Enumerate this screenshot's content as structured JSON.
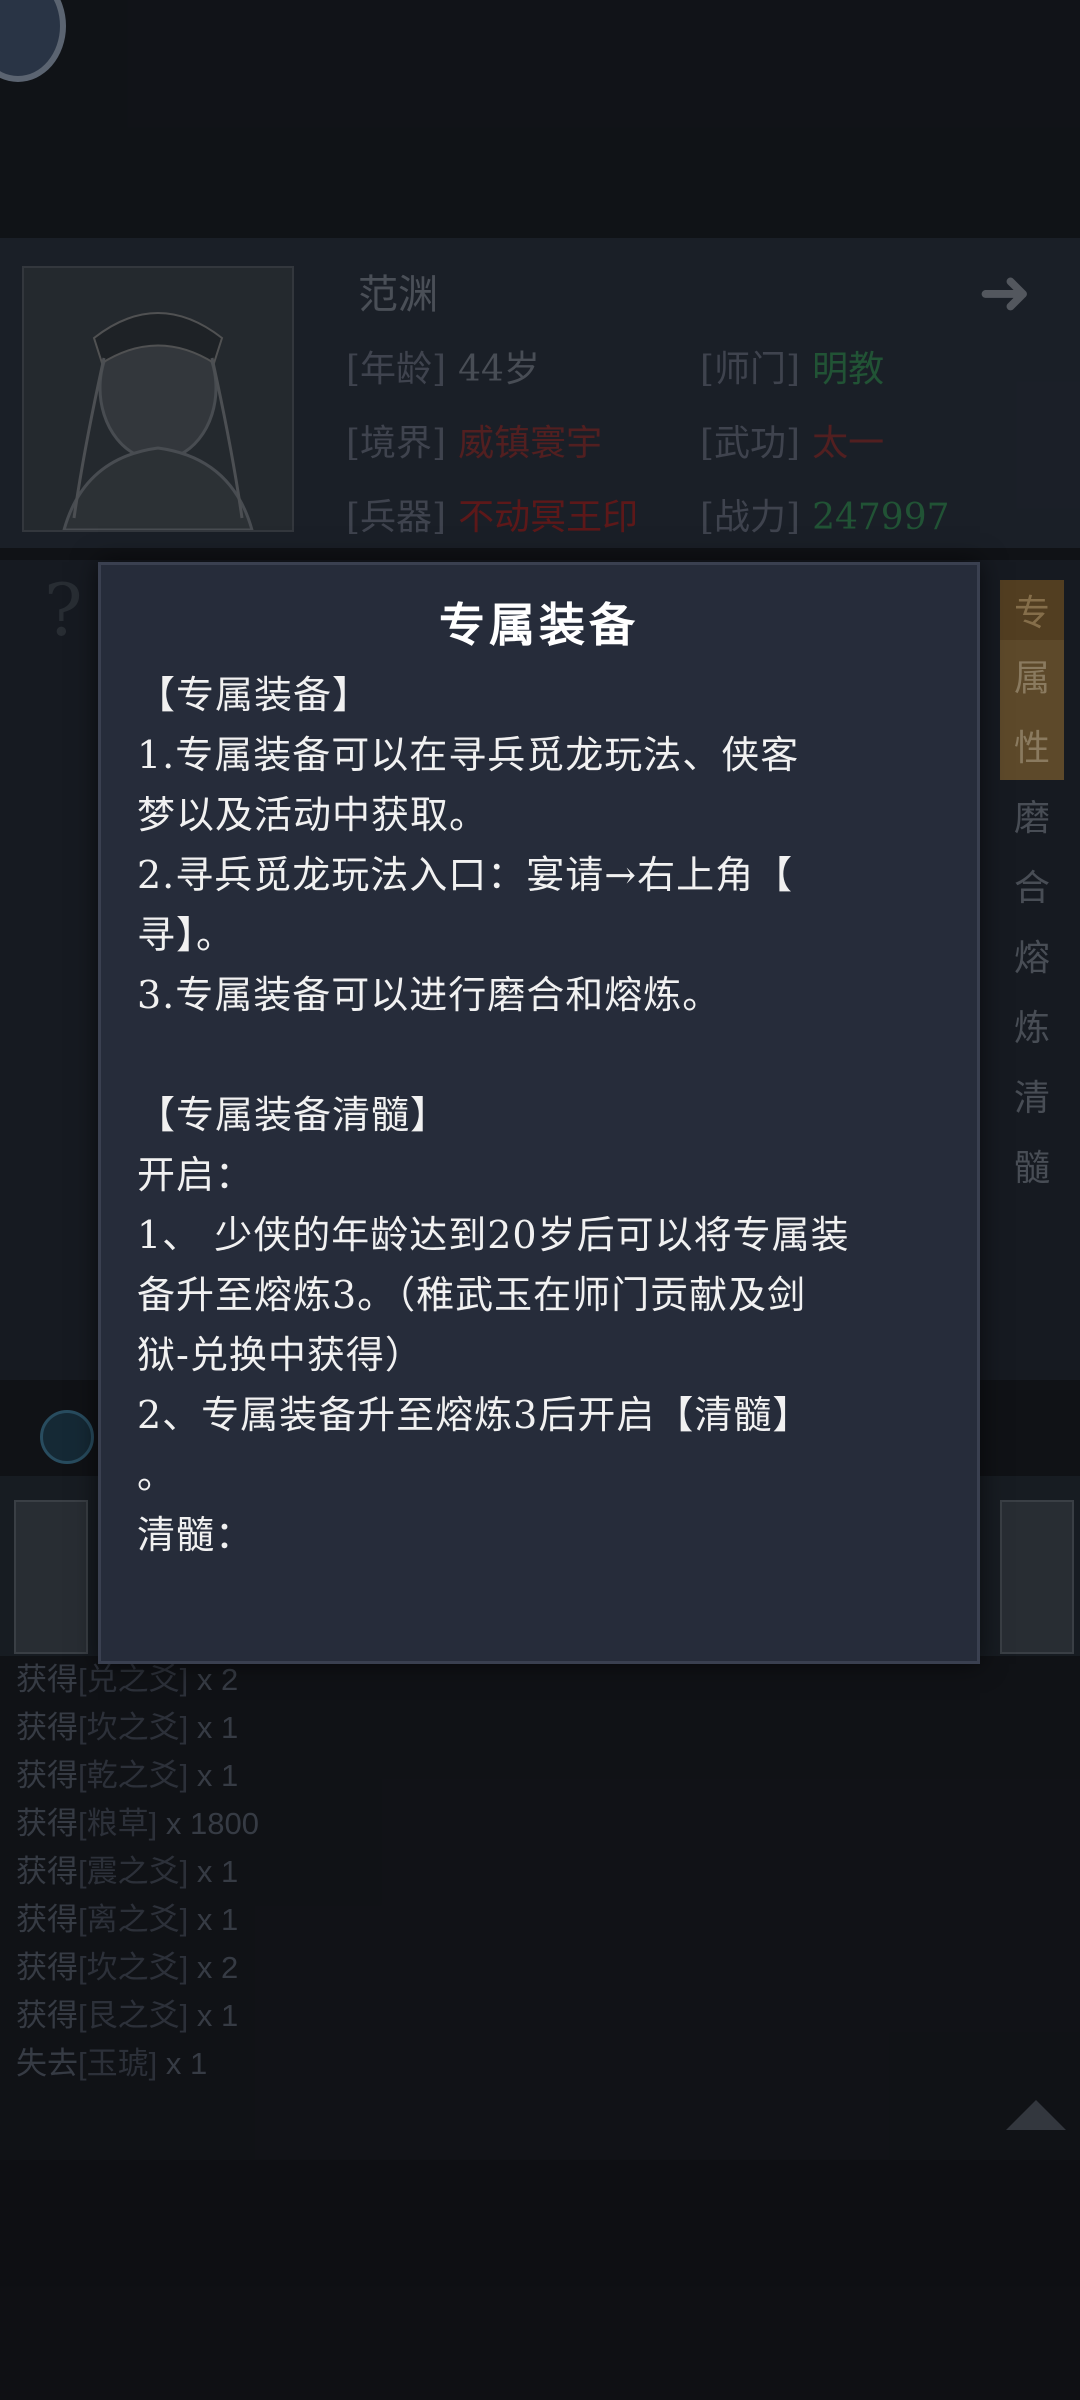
{
  "profile": {
    "name": "范渊",
    "next_arrow": "➜",
    "stats": [
      {
        "key": "[年龄]",
        "value": "44岁",
        "color": "#6b707b"
      },
      {
        "key": "[师门]",
        "value": "明教",
        "color": "#2f7a4a"
      },
      {
        "key": "[境界]",
        "value": "威镇寰宇",
        "color": "#7a2a2a"
      },
      {
        "key": "[武功]",
        "value": "太一",
        "color": "#7a2a2a"
      },
      {
        "key": "[兵器]",
        "value": "不动冥王印",
        "color": "#8a1f1f"
      },
      {
        "key": "[战力]",
        "value": "247997",
        "color": "#2f7a4a"
      }
    ]
  },
  "side_tabs": [
    "专",
    "属",
    "性",
    "磨",
    "合",
    "熔",
    "炼",
    "清",
    "髓"
  ],
  "log": [
    {
      "prefix": "获得",
      "item": "[兑之爻]",
      "qty": "x 2"
    },
    {
      "prefix": "获得",
      "item": "[坎之爻]",
      "qty": "x 1"
    },
    {
      "prefix": "获得",
      "item": "[乾之爻]",
      "qty": "x 1"
    },
    {
      "prefix": "获得",
      "item": "[粮草]",
      "qty": "x 1800"
    },
    {
      "prefix": "获得",
      "item": "[震之爻]",
      "qty": "x 1"
    },
    {
      "prefix": "获得",
      "item": "[离之爻]",
      "qty": "x 1"
    },
    {
      "prefix": "获得",
      "item": "[坎之爻]",
      "qty": "x 2"
    },
    {
      "prefix": "获得",
      "item": "[艮之爻]",
      "qty": "x 1"
    },
    {
      "prefix": "失去",
      "item": "[玉琥]",
      "qty": "x 1"
    }
  ],
  "modal": {
    "title": "专属装备",
    "lines": [
      "【专属装备】",
      "1.专属装备可以在寻兵觅龙玩法、侠客",
      "梦以及活动中获取。",
      "2.寻兵觅龙玩法入口：宴请→右上角【",
      "寻】。",
      "3.专属装备可以进行磨合和熔炼。",
      "",
      "【专属装备清髓】",
      " 开启：",
      "1、 少侠的年龄达到20岁后可以将专属装",
      "备升至熔炼3。（稚武玉在师门贡献及剑",
      "狱-兑换中获得）",
      "2、专属装备升至熔炼3后开启【清髓】",
      "。",
      "清髓："
    ]
  }
}
